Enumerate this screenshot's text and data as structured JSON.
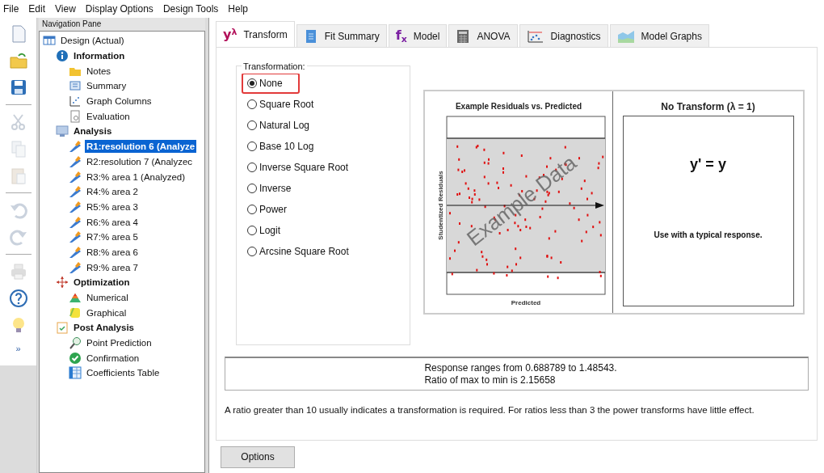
{
  "menu": [
    "File",
    "Edit",
    "View",
    "Display Options",
    "Design Tools",
    "Help"
  ],
  "toolbar": [
    {
      "kind": "new",
      "disabled": false
    },
    {
      "kind": "open",
      "disabled": false
    },
    {
      "kind": "save",
      "disabled": false
    },
    {
      "kind": "cut",
      "disabled": true
    },
    {
      "kind": "copy",
      "disabled": true
    },
    {
      "kind": "paste",
      "disabled": true
    },
    {
      "kind": "undo",
      "disabled": true
    },
    {
      "kind": "redo",
      "disabled": true
    },
    {
      "kind": "print",
      "disabled": true
    },
    {
      "kind": "help",
      "disabled": false
    },
    {
      "kind": "tip",
      "disabled": false
    },
    {
      "kind": "more",
      "disabled": false,
      "label": "»"
    }
  ],
  "navigation_pane": {
    "title": "Navigation Pane",
    "tree": [
      {
        "label": "Design (Actual)",
        "kind": "design",
        "selected": false,
        "children": [
          {
            "label": "Information",
            "kind": "info",
            "selected": false,
            "children": [
              {
                "label": "Notes",
                "kind": "notes",
                "selected": false
              },
              {
                "label": "Summary",
                "kind": "summary",
                "selected": false
              },
              {
                "label": "Graph Columns",
                "kind": "graph",
                "selected": false
              },
              {
                "label": "Evaluation",
                "kind": "evaluation",
                "selected": false
              }
            ]
          },
          {
            "label": "Analysis",
            "kind": "analysis",
            "selected": false,
            "children": [
              {
                "label": "R1:resolution 6 (Analyze",
                "kind": "response",
                "selected": true
              },
              {
                "label": "R2:resolution 7 (Analyzec",
                "kind": "response",
                "selected": false
              },
              {
                "label": "R3:% area 1 (Analyzed)",
                "kind": "response",
                "selected": false
              },
              {
                "label": "R4:% area 2",
                "kind": "response",
                "selected": false
              },
              {
                "label": "R5:% area 3",
                "kind": "response",
                "selected": false
              },
              {
                "label": "R6:% area 4",
                "kind": "response",
                "selected": false
              },
              {
                "label": "R7:% area 5",
                "kind": "response",
                "selected": false
              },
              {
                "label": "R8:% area 6",
                "kind": "response",
                "selected": false
              },
              {
                "label": "R9:% area 7",
                "kind": "response",
                "selected": false
              }
            ]
          },
          {
            "label": "Optimization",
            "kind": "optimization",
            "selected": false,
            "children": [
              {
                "label": "Numerical",
                "kind": "numerical",
                "selected": false
              },
              {
                "label": "Graphical",
                "kind": "graphical",
                "selected": false
              }
            ]
          },
          {
            "label": "Post Analysis",
            "kind": "post",
            "selected": false,
            "children": [
              {
                "label": "Point Prediction",
                "kind": "prediction",
                "selected": false
              },
              {
                "label": "Confirmation",
                "kind": "confirmation",
                "selected": false
              },
              {
                "label": "Coefficients Table",
                "kind": "coefficients",
                "selected": false
              }
            ]
          }
        ]
      }
    ]
  },
  "tabs": [
    {
      "label": "Transform",
      "kind": "transform",
      "symbol": [
        "y",
        "λ"
      ],
      "selected": true
    },
    {
      "label": "Fit Summary",
      "kind": "fit",
      "selected": false
    },
    {
      "label": "Model",
      "kind": "model",
      "symbol": [
        "f",
        "x"
      ],
      "selected": false
    },
    {
      "label": "ANOVA",
      "kind": "anova",
      "selected": false
    },
    {
      "label": "Diagnostics",
      "kind": "diagnostics",
      "selected": false
    },
    {
      "label": "Model Graphs",
      "kind": "graphs",
      "selected": false
    }
  ],
  "transformation": {
    "title": "Transformation:",
    "options": [
      {
        "label": "None",
        "selected": true,
        "highlighted": true
      },
      {
        "label": "Square Root",
        "selected": false,
        "highlighted": false
      },
      {
        "label": "Natural Log",
        "selected": false,
        "highlighted": false
      },
      {
        "label": "Base 10 Log",
        "selected": false,
        "highlighted": false
      },
      {
        "label": "Inverse Square Root",
        "selected": false,
        "highlighted": false
      },
      {
        "label": "Inverse",
        "selected": false,
        "highlighted": false
      },
      {
        "label": "Power",
        "selected": false,
        "highlighted": false
      },
      {
        "label": "Logit",
        "selected": false,
        "highlighted": false
      },
      {
        "label": "Arcsine Square Root",
        "selected": false,
        "highlighted": false
      }
    ]
  },
  "example_plot": {
    "title": "Example Residuals vs. Predicted",
    "ylabel": "Studentized Residuals",
    "xlabel": "Predicted",
    "overlay": "Example Data"
  },
  "transform_info": {
    "title": "No Transform (λ = 1)",
    "formula": "y' = y",
    "description": "Use with a typical response."
  },
  "response_info": [
    "Response ranges from 0.688789 to 1.48543.",
    "Ratio of max to min is 2.15658"
  ],
  "note": "A ratio greater than 10 usually indicates a transformation is required. For ratios less than 3 the power transforms have little effect.",
  "buttons": [
    "Options"
  ]
}
